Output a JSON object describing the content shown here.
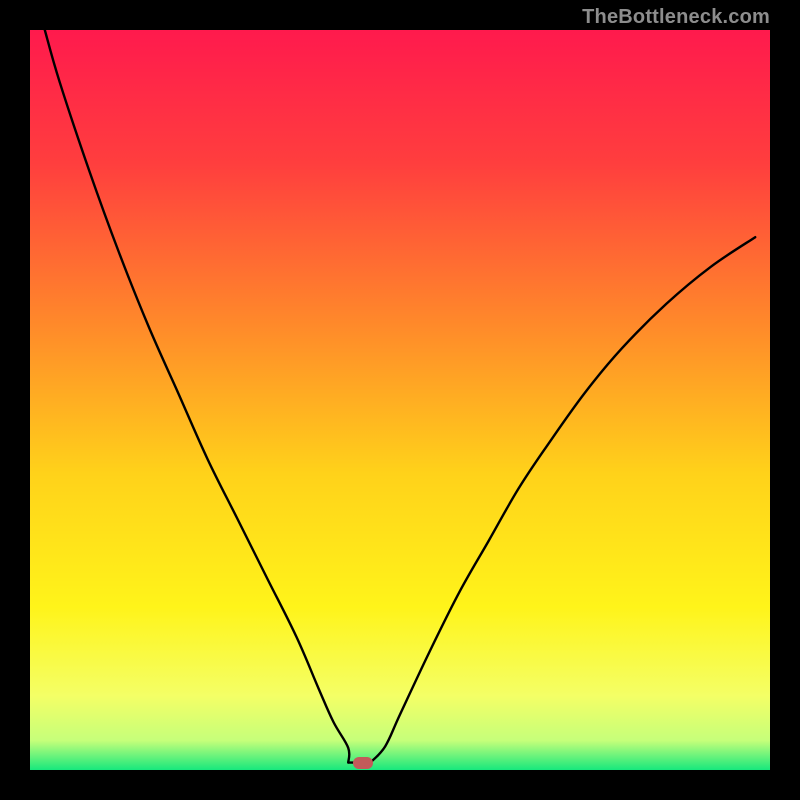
{
  "watermark": "TheBottleneck.com",
  "chart_data": {
    "type": "line",
    "title": "",
    "xlabel": "",
    "ylabel": "",
    "x_range": [
      0,
      100
    ],
    "y_range": [
      0,
      100
    ],
    "gradient_stops": [
      {
        "pct": 0,
        "color": "#ff1a4d"
      },
      {
        "pct": 18,
        "color": "#ff3e3e"
      },
      {
        "pct": 40,
        "color": "#ff8a2a"
      },
      {
        "pct": 60,
        "color": "#ffd21a"
      },
      {
        "pct": 78,
        "color": "#fff41a"
      },
      {
        "pct": 90,
        "color": "#f4ff66"
      },
      {
        "pct": 96,
        "color": "#c6ff7a"
      },
      {
        "pct": 100,
        "color": "#17e87d"
      }
    ],
    "series": [
      {
        "name": "bottleneck-curve",
        "color": "#000000",
        "width": 2.4,
        "x": [
          2,
          4,
          8,
          12,
          16,
          20,
          24,
          28,
          32,
          36,
          39,
          41,
          43,
          44,
          46,
          48,
          50,
          54,
          58,
          62,
          66,
          70,
          75,
          80,
          86,
          92,
          98
        ],
        "y": [
          100,
          93,
          81,
          70,
          60,
          51,
          42,
          34,
          26,
          18,
          11,
          6.5,
          3.0,
          1.0,
          1.0,
          3.2,
          7.5,
          16,
          24,
          31,
          38,
          44,
          51,
          57,
          63,
          68,
          72
        ]
      }
    ],
    "flat_segment": {
      "x0": 43,
      "x1": 46,
      "y": 1.0
    },
    "marker": {
      "x": 45,
      "y": 1.0,
      "color": "#c35a5a"
    }
  }
}
